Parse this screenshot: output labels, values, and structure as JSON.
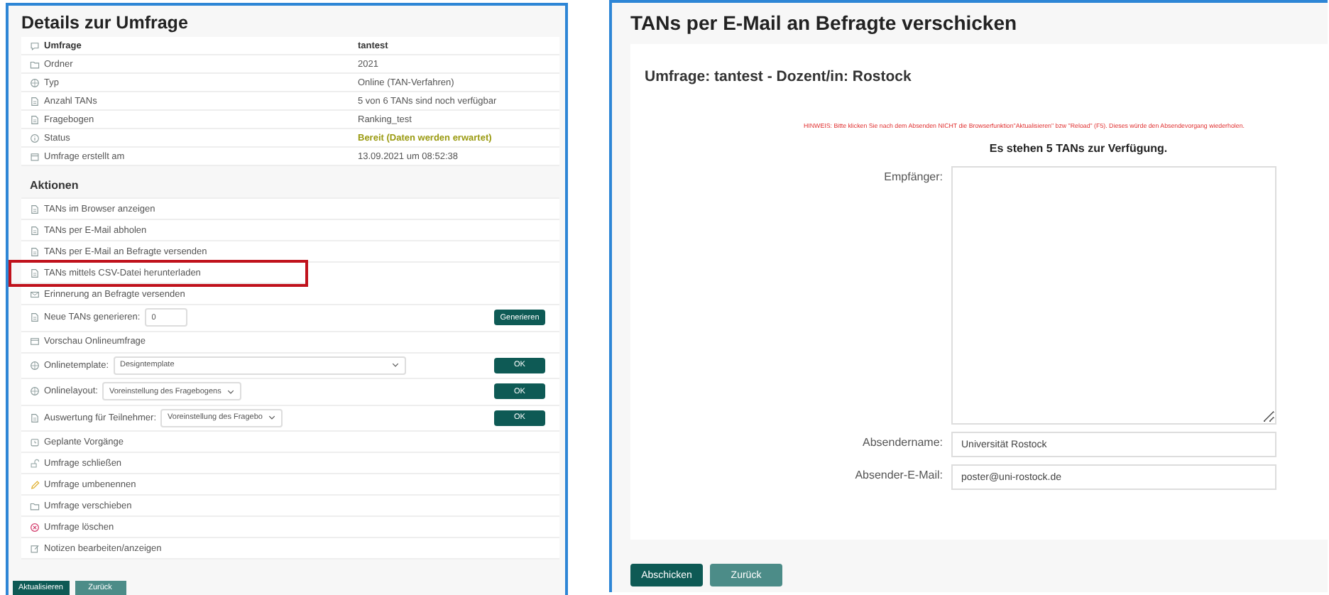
{
  "details": {
    "title": "Details zur Umfrage",
    "rows": [
      {
        "kind": "header",
        "label": "Umfrage",
        "value": "tantest"
      },
      {
        "kind": "plain",
        "label": "Ordner",
        "value": "2021"
      },
      {
        "kind": "plain",
        "label": "Typ",
        "value": "Online (TAN-Verfahren)"
      },
      {
        "kind": "plain",
        "label": "Anzahl TANs",
        "value": "5 von 6 TANs sind noch verfügbar"
      },
      {
        "kind": "plain",
        "label": "Fragebogen",
        "value": "Ranking_test"
      },
      {
        "kind": "status",
        "label": "Status",
        "value": "Bereit (Daten werden erwartet)"
      },
      {
        "kind": "plain",
        "label": "Umfrage erstellt am",
        "value": "13.09.2021 um 08:52:38"
      }
    ],
    "actions_title": "Aktionen",
    "actions": [
      {
        "kind": "link",
        "label": "TANs im Browser anzeigen",
        "highlighted": false
      },
      {
        "kind": "link",
        "label": "TANs per E-Mail abholen",
        "highlighted": false
      },
      {
        "kind": "link",
        "label": "TANs per E-Mail an Befragte versenden",
        "highlighted": false
      },
      {
        "kind": "link",
        "label": "TANs mittels CSV-Datei herunterladen",
        "highlighted": true
      },
      {
        "kind": "link",
        "label": "Erinnerung an Befragte versenden",
        "highlighted": false
      },
      {
        "kind": "number",
        "label": "Neue TANs generieren:",
        "value": "0",
        "button": "Generieren",
        "highlighted": false
      },
      {
        "kind": "link",
        "label": "Vorschau Onlineumfrage",
        "highlighted": false
      },
      {
        "kind": "select",
        "label": "Onlinetemplate:",
        "value": "Designtemplate",
        "wide": true,
        "button": "OK",
        "highlighted": false
      },
      {
        "kind": "select",
        "label": "Onlinelayout:",
        "value": "Voreinstellung des Fragebogens",
        "wide": false,
        "button": "OK",
        "highlighted": false
      },
      {
        "kind": "select",
        "label": "Auswertung für Teilnehmer:",
        "value": "Voreinstellung des Fragebo",
        "wide": false,
        "button": "OK",
        "highlighted": false
      },
      {
        "kind": "link",
        "label": "Geplante Vorgänge",
        "highlighted": false
      },
      {
        "kind": "link",
        "label": "Umfrage schließen",
        "highlighted": false
      },
      {
        "kind": "link",
        "label": "Umfrage umbenennen",
        "highlighted": false
      },
      {
        "kind": "link",
        "label": "Umfrage verschieben",
        "highlighted": false
      },
      {
        "kind": "link",
        "label": "Umfrage löschen",
        "highlighted": false
      },
      {
        "kind": "link",
        "label": "Notizen bearbeiten/anzeigen",
        "highlighted": false
      }
    ],
    "buttons": [
      "Aktualisieren",
      "Zurück"
    ]
  },
  "mail": {
    "title": "TANs per E-Mail an Befragte verschicken",
    "subtitle": "Umfrage: tantest - Dozent/in: Rostock",
    "notice": "HINWEIS: Bitte klicken Sie nach dem Absenden NICHT die Browserfunktion\"Aktualisieren\" bzw \"Reload\" (F5). Dieses würde den Absendevorgang wiederholen.",
    "available": "Es stehen 5 TANs zur Verfügung.",
    "recipients_label": "Empfänger:",
    "fields": [
      {
        "label": "Absendername:",
        "value": "Universität Rostock"
      },
      {
        "label": "Absender-E-Mail:",
        "value": "poster@uni-rostock.de"
      }
    ],
    "buttons": [
      "Abschicken",
      "Zurück"
    ]
  }
}
